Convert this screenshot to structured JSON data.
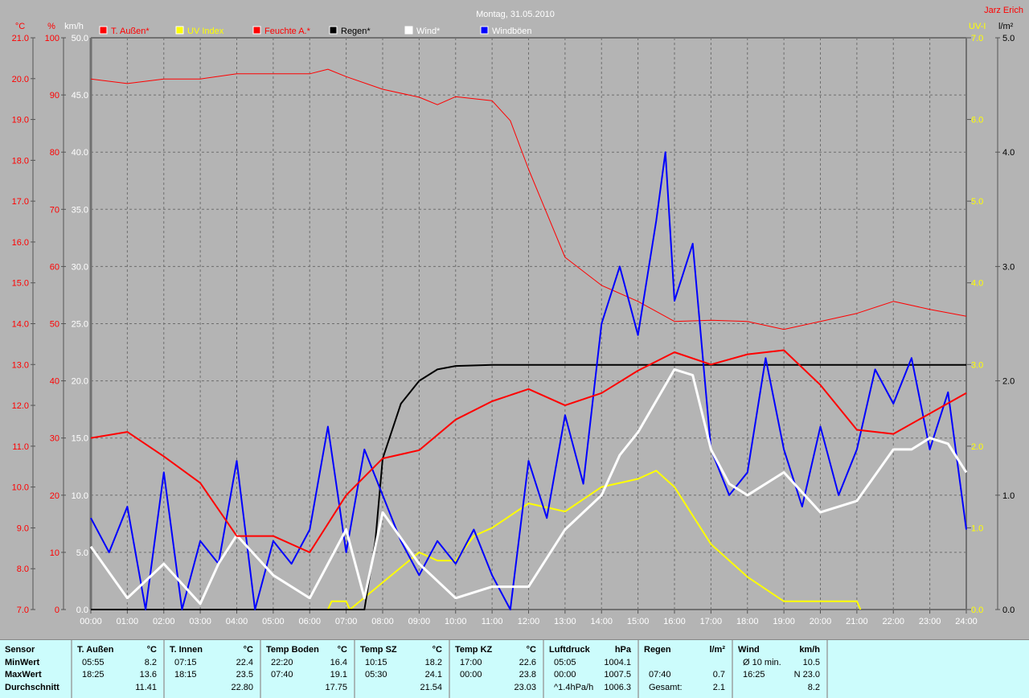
{
  "title": "Montag, 31.05.2010",
  "author": "Jarz Erich",
  "axes": {
    "temp_unit": "°C",
    "hum_unit": "%",
    "wind_unit": "km/h",
    "uv_unit": "UV-I",
    "rain_unit": "l/m²"
  },
  "legend": [
    {
      "label": "T. Außen*",
      "color": "#ff0000",
      "text_color": "#ff0000"
    },
    {
      "label": "UV Index",
      "color": "#ffff00",
      "text_color": "#ffff00"
    },
    {
      "label": "Feuchte A.*",
      "color": "#ff0000",
      "text_color": "#ff0000"
    },
    {
      "label": "Regen*",
      "color": "#000000",
      "text_color": "#000000"
    },
    {
      "label": "Wind*",
      "color": "#ffffff",
      "text_color": "#ffffff"
    },
    {
      "label": "Windböen",
      "color": "#0000ff",
      "text_color": "#ffffff"
    }
  ],
  "chart_data": {
    "type": "line",
    "title": "Montag, 31.05.2010",
    "x_ticks": [
      "00:00",
      "01:00",
      "02:00",
      "03:00",
      "04:00",
      "05:00",
      "06:00",
      "07:00",
      "08:00",
      "09:00",
      "10:00",
      "11:00",
      "12:00",
      "13:00",
      "14:00",
      "15:00",
      "16:00",
      "17:00",
      "18:00",
      "19:00",
      "20:00",
      "21:00",
      "22:00",
      "23:00",
      "24:00"
    ],
    "xlim": [
      0,
      24
    ],
    "y_axes": {
      "temp": {
        "ylim": [
          7,
          21
        ],
        "ticks": [
          "7.0",
          "8.0",
          "9.0",
          "10.0",
          "11.0",
          "12.0",
          "13.0",
          "14.0",
          "15.0",
          "16.0",
          "17.0",
          "18.0",
          "19.0",
          "20.0",
          "21.0"
        ]
      },
      "hum": {
        "ylim": [
          0,
          100
        ],
        "ticks": [
          "0",
          "10",
          "20",
          "30",
          "40",
          "50",
          "60",
          "70",
          "80",
          "90",
          "100"
        ]
      },
      "wind": {
        "ylim": [
          0,
          50
        ],
        "ticks": [
          "0.0",
          "5.0",
          "10.0",
          "15.0",
          "20.0",
          "25.0",
          "30.0",
          "35.0",
          "40.0",
          "45.0",
          "50.0"
        ]
      },
      "uv": {
        "ylim": [
          0,
          7
        ],
        "ticks": [
          "0.0",
          "1.0",
          "2.0",
          "3.0",
          "4.0",
          "5.0",
          "6.0",
          "7.0"
        ]
      },
      "rain": {
        "ylim": [
          0,
          5
        ],
        "ticks": [
          "0.0",
          "1.0",
          "2.0",
          "3.0",
          "4.0",
          "5.0"
        ]
      }
    },
    "series": [
      {
        "name": "Feuchte A.*",
        "axis": "hum",
        "color": "#ff0000",
        "width": 1,
        "x": [
          0,
          1,
          2,
          3,
          4,
          5,
          6,
          6.5,
          7,
          8,
          9,
          9.5,
          10,
          11,
          11.5,
          12,
          13,
          14,
          15,
          16,
          17,
          18,
          19,
          20,
          21,
          22,
          23,
          24
        ],
        "y": [
          92.8,
          92,
          92.8,
          92.8,
          93.7,
          93.7,
          93.7,
          94.5,
          93.2,
          91,
          89.6,
          88.3,
          89.7,
          89,
          85.5,
          77,
          61.6,
          56.7,
          53.9,
          50.4,
          50.6,
          50.4,
          49,
          50.4,
          51.8,
          53.9,
          52.5,
          51.3
        ]
      },
      {
        "name": "UV Index",
        "axis": "uv",
        "color": "#ffff00",
        "width": 2,
        "x": [
          0,
          6.5,
          6.6,
          7,
          7.1,
          9,
          9.5,
          10,
          10.5,
          11,
          12,
          13,
          14,
          15,
          15.5,
          16,
          17,
          18,
          19,
          20,
          21,
          21.1
        ],
        "y": [
          0,
          0,
          0.1,
          0.1,
          0,
          0.7,
          0.6,
          0.6,
          0.9,
          1.0,
          1.3,
          1.2,
          1.5,
          1.6,
          1.7,
          1.5,
          0.8,
          0.4,
          0.1,
          0.1,
          0.1,
          0
        ]
      },
      {
        "name": "Regen*",
        "axis": "rain",
        "color": "#000000",
        "width": 2,
        "x": [
          0,
          7.5,
          7.8,
          8,
          8.5,
          9,
          9.5,
          10,
          11,
          24
        ],
        "y": [
          0,
          0,
          0.6,
          1.32,
          1.8,
          2.0,
          2.1,
          2.13,
          2.14,
          2.14
        ]
      },
      {
        "name": "Windböen",
        "axis": "wind",
        "color": "#0000ff",
        "width": 2,
        "x": [
          0,
          0.5,
          1,
          1.5,
          2,
          2.5,
          3,
          3.5,
          4,
          4.5,
          5,
          5.5,
          6,
          6.5,
          7,
          7.5,
          8,
          8.5,
          9,
          9.5,
          10,
          10.5,
          11,
          11.5,
          12,
          12.5,
          13,
          13.5,
          14,
          14.5,
          15,
          15.5,
          15.75,
          16,
          16.5,
          17,
          17.5,
          18,
          18.5,
          19,
          19.5,
          20,
          20.5,
          21,
          21.5,
          22,
          22.5,
          23,
          23.5,
          24
        ],
        "y": [
          8,
          5,
          9,
          0,
          12,
          0,
          6,
          4,
          13,
          0,
          6,
          4,
          7,
          16,
          5,
          14,
          10,
          6,
          3,
          6,
          4,
          7,
          3,
          0,
          13,
          8,
          17,
          11,
          25,
          30,
          24,
          34,
          40,
          27,
          32,
          14,
          10,
          12,
          22,
          14,
          9,
          16,
          10,
          14,
          21,
          18,
          22,
          14,
          19,
          7
        ]
      },
      {
        "name": "Wind*",
        "axis": "wind",
        "color": "#ffffff",
        "width": 3,
        "x": [
          0,
          1,
          2,
          3,
          3.5,
          4,
          5,
          6,
          7,
          7.5,
          8,
          9,
          10,
          11,
          12,
          13,
          14,
          14.5,
          15,
          16,
          16.5,
          17,
          17.5,
          18,
          19,
          20,
          21,
          22,
          22.5,
          23,
          23.5,
          24
        ],
        "y": [
          5.5,
          1,
          4,
          0.5,
          4,
          6.5,
          3,
          1,
          7,
          1,
          8.5,
          4,
          1,
          2,
          2,
          7,
          10,
          13.5,
          15.5,
          21,
          20.5,
          14,
          11,
          10,
          12,
          8.5,
          9.5,
          14,
          14,
          15,
          14.5,
          12
        ]
      },
      {
        "name": "T. Außen*",
        "axis": "temp",
        "color": "#ff0000",
        "width": 2,
        "x": [
          0,
          1,
          2,
          3,
          4,
          5,
          6,
          7,
          8,
          9,
          10,
          11,
          12,
          13,
          14,
          15,
          16,
          17,
          18,
          19,
          20,
          21,
          22,
          23,
          24
        ],
        "y": [
          11.2,
          11.35,
          10.75,
          10.1,
          8.8,
          8.8,
          8.4,
          9.8,
          10.7,
          10.9,
          11.65,
          12.1,
          12.4,
          12,
          12.3,
          12.85,
          13.3,
          13,
          13.25,
          13.35,
          12.5,
          11.4,
          11.3,
          11.8,
          12.3
        ]
      }
    ]
  },
  "table": [
    {
      "h": "Sensor",
      "u": "",
      "rows": [
        [
          "MinWert",
          "",
          ""
        ],
        [
          "MaxWert",
          "",
          ""
        ],
        [
          "Durchschnitt",
          "",
          ""
        ]
      ]
    },
    {
      "h": "T. Außen",
      "u": "°C",
      "rows": [
        [
          "05:55",
          "8.2"
        ],
        [
          "18:25",
          "13.6"
        ],
        [
          "",
          "11.41"
        ]
      ]
    },
    {
      "h": "T. Innen",
      "u": "°C",
      "rows": [
        [
          "07:15",
          "22.4"
        ],
        [
          "18:15",
          "23.5"
        ],
        [
          "",
          "22.80"
        ]
      ]
    },
    {
      "h": "Temp Boden",
      "u": "°C",
      "rows": [
        [
          "22:20",
          "16.4"
        ],
        [
          "07:40",
          "19.1"
        ],
        [
          "",
          "17.75"
        ]
      ]
    },
    {
      "h": "Temp SZ",
      "u": "°C",
      "rows": [
        [
          "10:15",
          "18.2"
        ],
        [
          "05:30",
          "24.1"
        ],
        [
          "",
          "21.54"
        ]
      ]
    },
    {
      "h": "Temp KZ",
      "u": "°C",
      "rows": [
        [
          "17:00",
          "22.6"
        ],
        [
          "00:00",
          "23.8"
        ],
        [
          "",
          "23.03"
        ]
      ]
    },
    {
      "h": "Luftdruck",
      "u": "hPa",
      "rows": [
        [
          "05:05",
          "1004.1"
        ],
        [
          "00:00",
          "1007.5"
        ],
        [
          "^1.4hPa/h",
          "1006.3"
        ]
      ]
    },
    {
      "h": "Regen",
      "u": "l/m²",
      "rows": [
        [
          "",
          ""
        ],
        [
          "07:40",
          "0.7"
        ],
        [
          "Gesamt:",
          "2.1"
        ]
      ]
    },
    {
      "h": "Wind",
      "u": "km/h",
      "rows": [
        [
          "Ø 10 min.",
          "10.5"
        ],
        [
          "16:25",
          "N 23.0"
        ],
        [
          "",
          "8.2"
        ]
      ]
    }
  ]
}
